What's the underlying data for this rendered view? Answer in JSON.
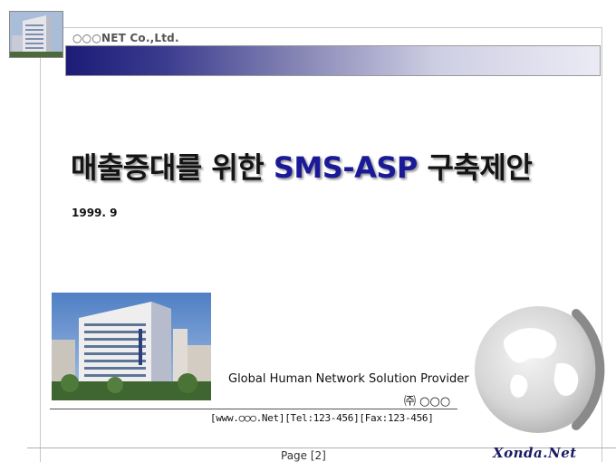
{
  "header": {
    "company": "○○○NET Co.,Ltd."
  },
  "title": {
    "prefix": "매출증대를 위한 ",
    "accent": "SMS-ASP",
    "suffix": " 구축제안"
  },
  "date": "1999. 9",
  "footer": {
    "provider": "Global Human Network Solution Provider",
    "corp": "㈜ ○○○",
    "contact": "[www.○○○.Net][Tel:123-456][Fax:123-456]",
    "page": "Page [2]",
    "brand": "Xonda.Net"
  },
  "colors": {
    "header_gradient_start": "#1c1c78",
    "header_gradient_end": "#ebebf5",
    "title_accent": "#1a1a99"
  }
}
